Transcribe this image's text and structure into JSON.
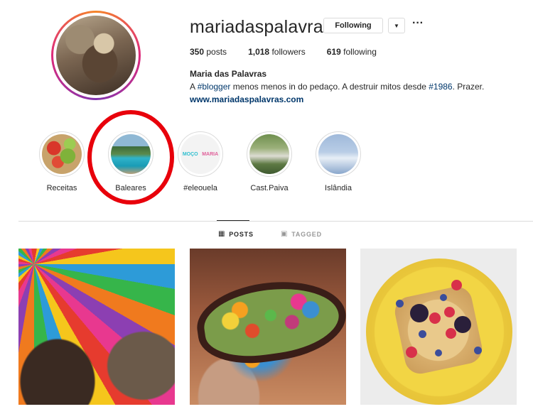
{
  "profile": {
    "username": "mariadaspalavras",
    "following_button": "Following",
    "dropdown_icon": "chevron-down-icon",
    "more_icon": "more-options-icon",
    "stats": {
      "posts_count": "350",
      "posts_label": "posts",
      "followers_count": "1,018",
      "followers_label": "followers",
      "following_count": "619",
      "following_label": "following"
    },
    "full_name": "Maria das Palavras",
    "bio_prefix": "A ",
    "bio_tag1": "#blogger",
    "bio_middle": " menos menos in do pedaço. A destruir mitos desde ",
    "bio_tag2": "#1986",
    "bio_suffix": ". Prazer.",
    "website": "www.mariadaspalavras.com"
  },
  "highlights": [
    {
      "label": "Receitas"
    },
    {
      "label": "Baleares"
    },
    {
      "label": "#eleouela",
      "cover_left": "MOÇO",
      "cover_right": "MARIA"
    },
    {
      "label": "Cast.Paiva"
    },
    {
      "label": "Islândia"
    }
  ],
  "tabs": {
    "posts": {
      "label": "POSTS",
      "icon": "grid-icon",
      "active": true
    },
    "tagged": {
      "label": "TAGGED",
      "icon": "tagged-icon",
      "active": false
    }
  },
  "colors": {
    "annotation": "#e8000b",
    "link": "#00376b",
    "text": "#262626",
    "muted": "#999999",
    "border": "#dbdbdb"
  }
}
